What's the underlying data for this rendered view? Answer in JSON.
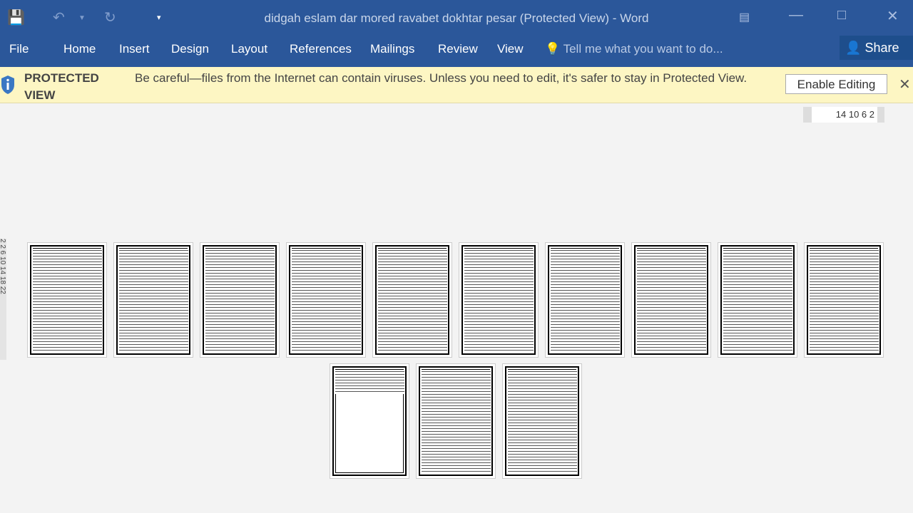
{
  "window": {
    "title": "didgah eslam dar mored ravabet dokhtar pesar (Protected View) - Word"
  },
  "ribbon": {
    "tabs": [
      "File",
      "Home",
      "Insert",
      "Design",
      "Layout",
      "References",
      "Mailings",
      "Review",
      "View"
    ],
    "tell_me": "Tell me what you want to do...",
    "share": "Share"
  },
  "protected_view": {
    "label": "PROTECTED VIEW",
    "message": "Be careful—files from the Internet can contain viruses. Unless you need to edit, it's safer to stay in Protected View.",
    "enable_button": "Enable Editing"
  },
  "ruler": {
    "labels": "14 10 6 2",
    "vertical": "2 2 6 10 14 18 22"
  },
  "document": {
    "page_count": 13,
    "blank_page_index": 11
  },
  "colors": {
    "accent": "#2b579a",
    "bar": "#fdf6c3"
  }
}
